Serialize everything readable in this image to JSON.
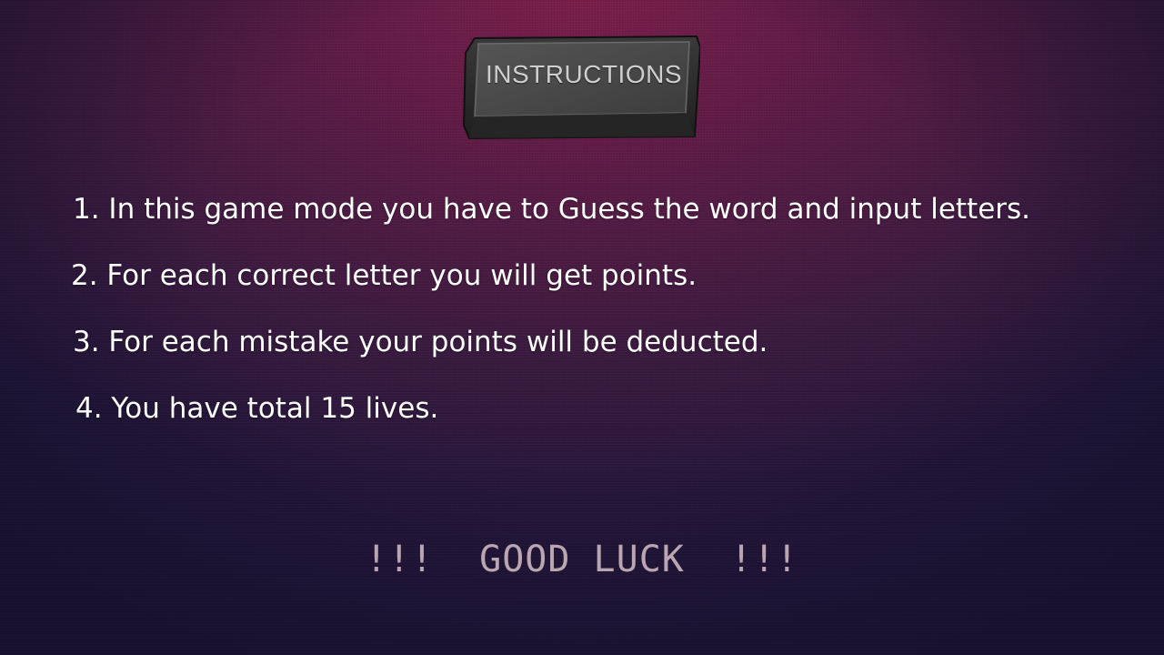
{
  "title": "INSTRUCTIONS",
  "rules": [
    "1. In this game mode you have to Guess the word and input letters.",
    "2. For each correct letter you will get points.",
    "3. For each mistake your points will be deducted.",
    "4. You have total 15 lives."
  ],
  "footer": "!!!  GOOD LUCK  !!!",
  "colors": {
    "rule_text": "#ffffff",
    "footer_text": "#b9a6b0",
    "key_face": "#4a4a4a",
    "title_text": "#cfcfcf"
  }
}
